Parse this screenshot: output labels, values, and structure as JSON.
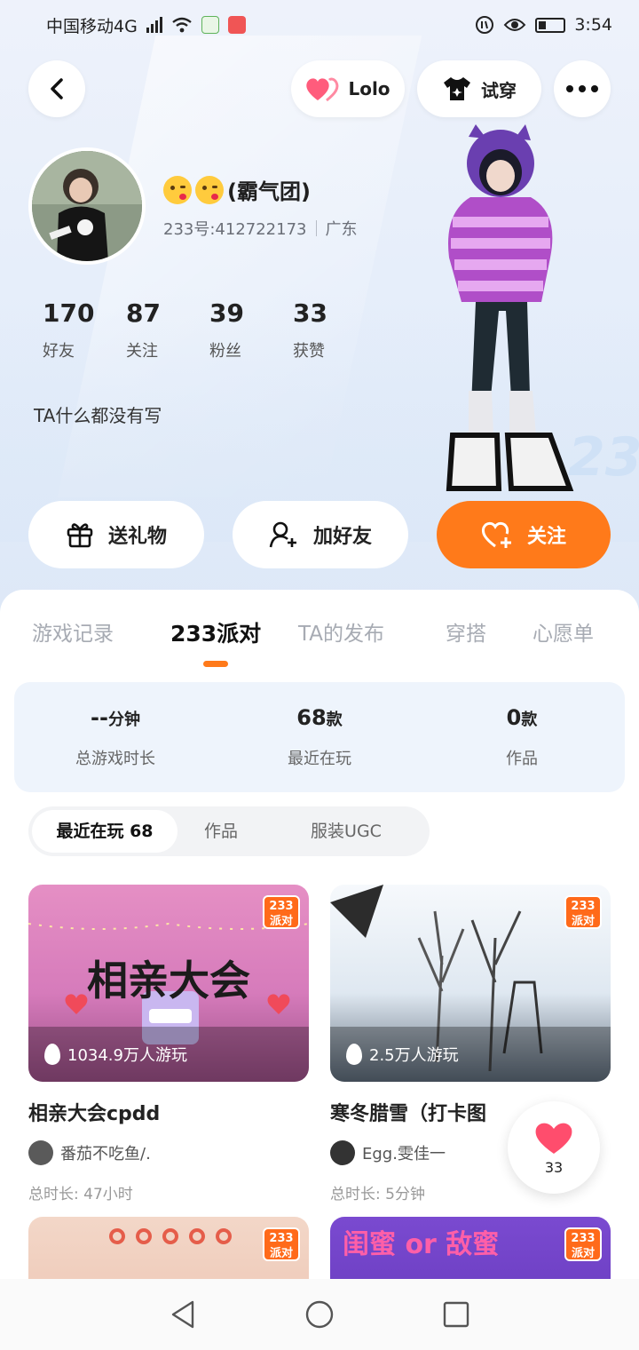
{
  "status_bar": {
    "carrier": "中国移动4G",
    "net_small": "4G",
    "time": "3:54"
  },
  "header": {
    "like_label": "Lolo",
    "try_on_label": "试穿"
  },
  "profile": {
    "nickname": "(霸气团)",
    "id_text": "233号:412722173",
    "region": "广东",
    "stats": [
      {
        "num": "170",
        "label": "好友"
      },
      {
        "num": "87",
        "label": "关注"
      },
      {
        "num": "39",
        "label": "粉丝"
      },
      {
        "num": "33",
        "label": "获赞"
      }
    ],
    "bio": "TA什么都没有写",
    "deco_text": "233"
  },
  "actions": {
    "gift": "送礼物",
    "add_friend": "加好友",
    "follow": "关注"
  },
  "tabs": [
    "游戏记录",
    "233派对",
    "TA的发布",
    "穿搭",
    "心愿单"
  ],
  "active_tab": 1,
  "summary": [
    {
      "value": "--",
      "unit": "分钟",
      "label": "总游戏时长"
    },
    {
      "value": "68",
      "unit": "款",
      "label": "最近在玩"
    },
    {
      "value": "0",
      "unit": "款",
      "label": "作品"
    }
  ],
  "segments": [
    "最近在玩 68",
    "作品",
    "服装UGC"
  ],
  "badge_text": {
    "top": "233",
    "bottom": "派对"
  },
  "cards": [
    {
      "banner": "相亲大会",
      "plays": "1034.9万人游玩",
      "title": "相亲大会cpdd",
      "author": "番茄不吃鱼/.",
      "duration": "总时长: 47小时"
    },
    {
      "banner": "",
      "plays": "2.5万人游玩",
      "title": "寒冬腊雪（打卡图",
      "author": "Egg.雯佳一",
      "duration": "总时长: 5分钟"
    },
    {
      "banner": "",
      "plays": "",
      "title": "",
      "author": "",
      "duration": ""
    },
    {
      "banner": "闺蜜 or 敌蜜",
      "plays": "",
      "title": "",
      "author": "",
      "duration": ""
    }
  ],
  "like_fab": {
    "count": "33"
  },
  "colors": {
    "accent": "#ff7a1a",
    "summary_bg": "#eef4fc",
    "heart": "#ff4d6d"
  }
}
